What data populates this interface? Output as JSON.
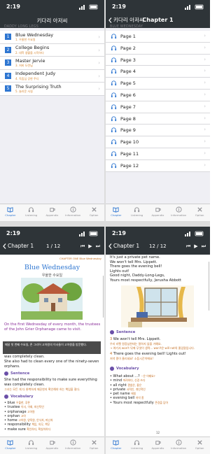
{
  "status": {
    "time": "2:19"
  },
  "screen1": {
    "nav_title": "키다리 아저씨",
    "section": "DADDY LONG LEGS",
    "chapters": [
      {
        "num": "1",
        "title": "Blue Wednesday",
        "sub": "1. 우울한 수요일"
      },
      {
        "num": "2",
        "title": "College Begins",
        "sub": "2. 대학 생활을 시작하다"
      },
      {
        "num": "3",
        "title": "Master Jervie",
        "sub": "3. 저비 도련님"
      },
      {
        "num": "4",
        "title": "Independent Judy",
        "sub": "4. 독립심 강한 주디"
      },
      {
        "num": "5",
        "title": "The Surprising Truth",
        "sub": "5. 놀라운 사실"
      }
    ]
  },
  "screen2": {
    "back": "키다리 아저씨",
    "nav_title": "Chapter 1",
    "section": "BLUE WEDNESDAY",
    "pages": [
      "Page 1",
      "Page 2",
      "Page 3",
      "Page 4",
      "Page 5",
      "Page 6",
      "Page 7",
      "Page 8",
      "Page 9",
      "Page 10",
      "Page 11",
      "Page 12"
    ]
  },
  "screen3": {
    "back": "Chapter 1",
    "page": "1 / 12",
    "chapter_label": "CHAPTER ONE  Blue Wednesday",
    "title": "Blue Wednesday",
    "title_ko": "우울한 수요일",
    "intro": "On the first Wednesday of every month, the trustees of the John Grier Orphanage came to visit.",
    "popup": "매달 첫 번째 수요일, 존 그리어 고아원의 이사들이 고아원을 방문했다.",
    "body1": "was completely clean.",
    "body2": "She also had to clean every one of the ninety-seven orphans.",
    "sentence_head": "Sentence",
    "sentence": "She had the responsibility to make sure everything was completely clean.",
    "sentence_ko": "그녀는 모든 게 다 완벽하게 깨끗한지 확인해야 하는 책임을 졌다.",
    "vocab_head": "Vocabulary",
    "vocab": [
      {
        "en": "blue",
        "ko": "우울한, 푸른"
      },
      {
        "en": "trustee",
        "ko": "이사, 이회, 피신탁인"
      },
      {
        "en": "orphanage",
        "ko": "고아원"
      },
      {
        "en": "orphan",
        "ko": "고아"
      },
      {
        "en": "home",
        "ko": "고아원, 양육원, 안식처, 피난처"
      },
      {
        "en": "responsibility",
        "ko": "책임, 의무, 책무"
      },
      {
        "en": "make sure",
        "ko": "확인하다, 확실히하다"
      }
    ]
  },
  "screen4": {
    "back": "Chapter 1",
    "page": "12 / 12",
    "lines": [
      "It's just a private pet name.",
      "We won't tell Mrs. Lippett.",
      "There goes the evening bell!",
      "Lights out!",
      "Good night, Daddy-Long-Legs,",
      "Yours most respectfully, Jerusha Abbott"
    ],
    "sentence_head": "Sentence",
    "s3": "We won't tell Mrs. Lippett.",
    "s3_note": "우리 리펫 원장님한테는 말하지 않을 거예요.",
    "s3_ko": "→ 여기서 won't 뒤에 무엇이 생략... won't은 will not의 줄임말입니다.",
    "s4": "There goes the evening bell! Lights out!",
    "s4_ko": "저녁 종이 울리네요! 소등시간이에요!",
    "vocab_head": "Vocabulary",
    "vocab": [
      {
        "en": "What about ...?",
        "ko": "~은 어때요?"
      },
      {
        "en": "mind",
        "ko": "꺼려하다, 신경 쓰다"
      },
      {
        "en": "all right",
        "ko": "괜찮은, 좋은"
      },
      {
        "en": "private",
        "ko": "사적인, 개인적인"
      },
      {
        "en": "pet name",
        "ko": "애칭"
      },
      {
        "en": "evening bell",
        "ko": "저녁 종"
      },
      {
        "en": "Yours most respectfully",
        "ko": "존경을 담아"
      }
    ],
    "page_num": "12"
  },
  "tabs": [
    {
      "label": "Chapter",
      "icon": "book-icon"
    },
    {
      "label": "Listening",
      "icon": "headphones-icon"
    },
    {
      "label": "Appendix",
      "icon": "cup-icon"
    },
    {
      "label": "Information",
      "icon": "info-icon"
    },
    {
      "label": "Option",
      "icon": "tools-icon"
    }
  ],
  "colors": {
    "nav": "#2e3438",
    "accent": "#2e76d1",
    "orange": "#d4832c",
    "purple": "#8a2f9a"
  }
}
